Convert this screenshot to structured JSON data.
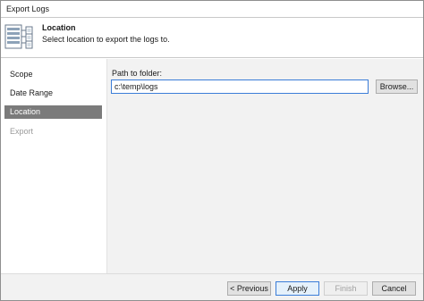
{
  "window": {
    "title": "Export Logs"
  },
  "header": {
    "title": "Location",
    "description": "Select location to export the logs to.",
    "icon": "export-logs-icon"
  },
  "sidebar": {
    "items": [
      {
        "label": "Scope",
        "state": "normal"
      },
      {
        "label": "Date Range",
        "state": "normal"
      },
      {
        "label": "Location",
        "state": "active"
      },
      {
        "label": "Export",
        "state": "disabled"
      }
    ]
  },
  "main": {
    "path_label": "Path to folder:",
    "path_value": "c:\\temp\\logs",
    "browse_label": "Browse..."
  },
  "footer": {
    "previous_label": "< Previous",
    "apply_label": "Apply",
    "finish_label": "Finish",
    "cancel_label": "Cancel"
  },
  "colors": {
    "active_nav": "#7b7b7b",
    "focus_border": "#3b7dd8",
    "panel_bg": "#f2f2f2"
  }
}
